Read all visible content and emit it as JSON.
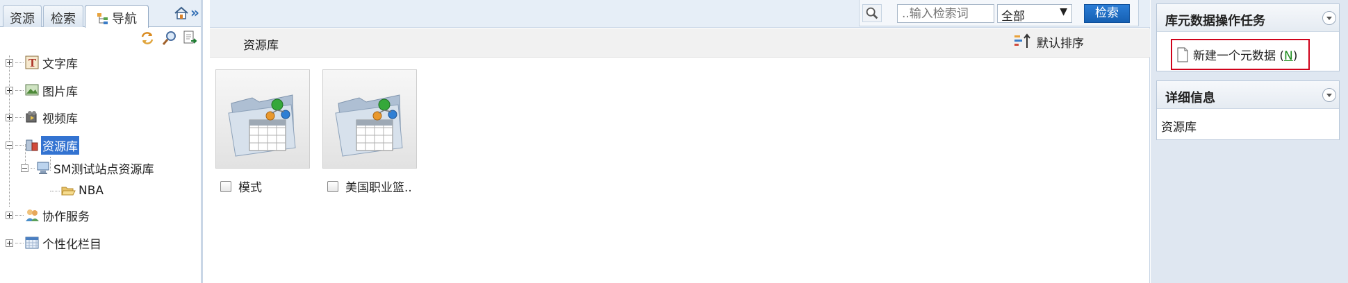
{
  "left_panel": {
    "tabs": [
      {
        "label": "资源"
      },
      {
        "label": "检索"
      },
      {
        "label": "导航"
      }
    ],
    "more_glyph": "»",
    "tree": [
      {
        "label": "文字库",
        "icon": "text-library-icon"
      },
      {
        "label": "图片库",
        "icon": "image-library-icon"
      },
      {
        "label": "视频库",
        "icon": "video-library-icon"
      },
      {
        "label": "资源库",
        "icon": "resource-library-icon",
        "selected": true
      },
      {
        "label": "SM测试站点资源库",
        "icon": "site-computer-icon"
      },
      {
        "label": "NBA",
        "icon": "folder-open-icon"
      },
      {
        "label": "协作服务",
        "icon": "collaboration-icon"
      },
      {
        "label": "个性化栏目",
        "icon": "custom-column-icon"
      }
    ]
  },
  "search": {
    "placeholder": "..输入检索词",
    "scope_value": "全部",
    "button_label": "检索"
  },
  "main": {
    "breadcrumb": "资源库",
    "sort_label": "默认排序",
    "items": [
      {
        "label": "模式"
      },
      {
        "label": "美国职业篮.."
      }
    ]
  },
  "right_panel": {
    "tasks_title": "库元数据操作任务",
    "task_label": "新建一个元数据",
    "task_shortcut_open": "(",
    "task_shortcut_key": "N",
    "task_shortcut_close": ")",
    "details_title": "详细信息",
    "details_value": "资源库"
  },
  "colors": {
    "selection": "#3373d1",
    "accent_button": "#1a6cc4",
    "highlight_border": "#d0021b",
    "shortcut_key": "#1a8a1a"
  }
}
